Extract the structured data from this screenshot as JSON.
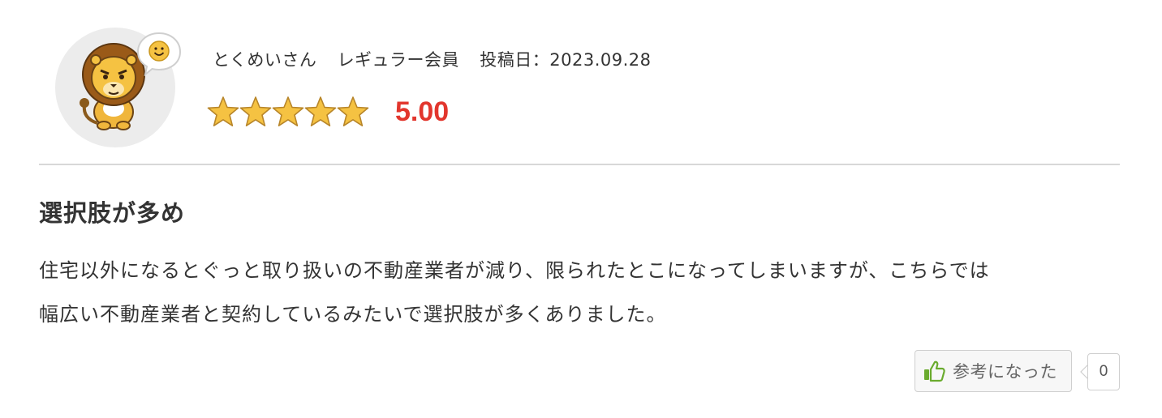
{
  "review": {
    "author": "とくめいさん",
    "member_rank": "レギュラー会員",
    "date_label": "投稿日：",
    "date": "2023.09.28",
    "rating": "5.00",
    "star_count": 5,
    "title": "選択肢が多め",
    "body_lines": [
      "住宅以外になるとぐっと取り扱いの不動産業者が減り、限られたとこになってしまいますが、こちらでは",
      "幅広い不動産業者と契約しているみたいで選択肢が多くありました。"
    ]
  },
  "helpful": {
    "label": "参考になった",
    "count": "0"
  },
  "icons": {
    "avatar": "lion-mascot-icon",
    "mood": "smile-bubble-icon",
    "star": "star-icon",
    "helpful": "thumbs-up-icon"
  },
  "colors": {
    "score": "#e2362d",
    "star_fill": "#f5c242",
    "thumb": "#6aab2e"
  }
}
